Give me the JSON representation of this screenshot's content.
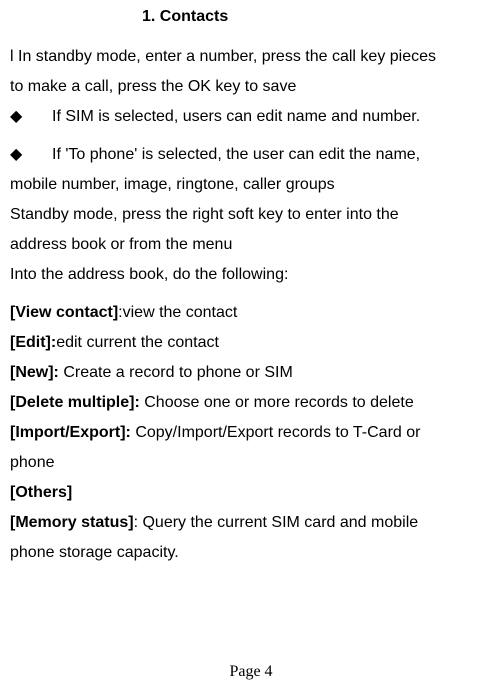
{
  "heading": "1.    Contacts",
  "intro_line1": "l In standby mode, enter a number, press the call key pieces",
  "intro_line2": "to make a call, press the OK key to save",
  "bullet1": "If   SIM is selected, users can edit name and number.",
  "bullet2_first": "If 'To phone' is selected, the user can edit the name,",
  "bullet2_cont": "mobile number, image, ringtone, caller groups",
  "standby_line1": "Standby mode, press the right soft key to enter into the",
  "standby_line2": "address book or from the menu",
  "intro_do": "Into the address book, do the following:",
  "items": {
    "view_contact_label": "[View contact]",
    "view_contact_text": ":view the contact",
    "edit_label": "[Edit]:",
    "edit_text": "edit current the contact",
    "new_label": "[New]: ",
    "new_text": "Create a record to phone or SIM",
    "delete_label": "[Delete multiple]: ",
    "delete_text": "Choose one or more records to delete",
    "import_label": "[Import/Export]: ",
    "import_text_line1": "Copy/Import/Export records to T-Card or",
    "import_text_line2": "phone",
    "others_label": "[Others]",
    "memory_label": "[Memory status]",
    "memory_text_line1": ": Query the current SIM card and mobile",
    "memory_text_line2": "phone storage capacity."
  },
  "page_number": "Page 4"
}
